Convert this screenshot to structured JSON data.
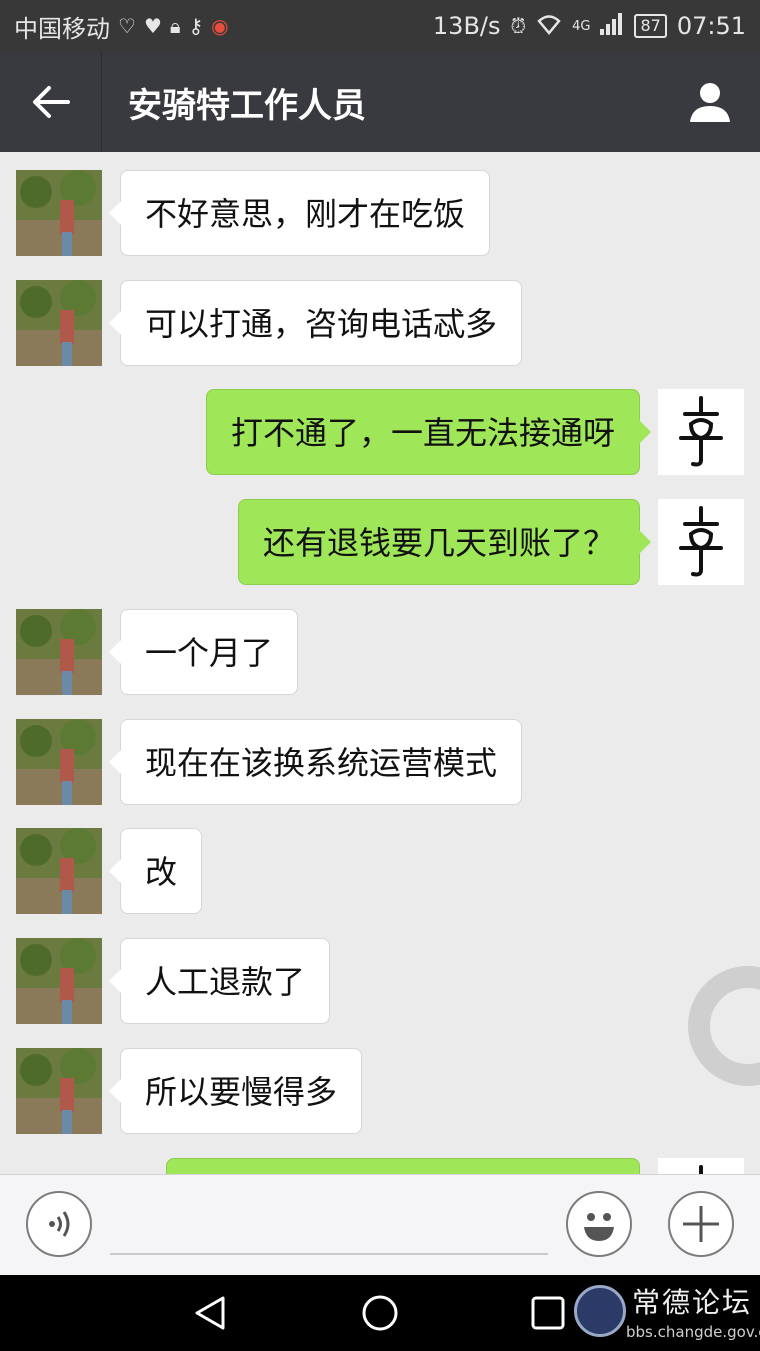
{
  "status_bar": {
    "carrier": "中国移动",
    "network_speed": "13B/s",
    "network_type": "4G",
    "battery": "87",
    "time": "07:51"
  },
  "nav": {
    "title": "安骑特工作人员",
    "back_icon": "arrow-left-icon",
    "profile_icon": "person-icon"
  },
  "messages": [
    {
      "side": "in",
      "text": "不好意思，刚才在吃饭"
    },
    {
      "side": "in",
      "text": "可以打通，咨询电话忒多"
    },
    {
      "side": "out",
      "text": "打不通了，一直无法接通呀"
    },
    {
      "side": "out",
      "text": "还有退钱要几天到账了？"
    },
    {
      "side": "in",
      "text": "一个月了"
    },
    {
      "side": "in",
      "text": "现在在该换系统运营模式"
    },
    {
      "side": "in",
      "text": "改"
    },
    {
      "side": "in",
      "text": "人工退款了"
    },
    {
      "side": "in",
      "text": "所以要慢得多"
    },
    {
      "side": "out",
      "text": ""
    }
  ],
  "input_bar": {
    "voice_icon": "voice-icon",
    "emoji_icon": "emoji-icon",
    "plus_icon": "plus-icon"
  },
  "colors": {
    "outgoing_bubble": "#9fe658",
    "incoming_bubble": "#ffffff",
    "nav_bg": "#393a3f"
  },
  "watermark": {
    "title": "常德论坛",
    "url": "bbs.changde.gov.cn"
  }
}
